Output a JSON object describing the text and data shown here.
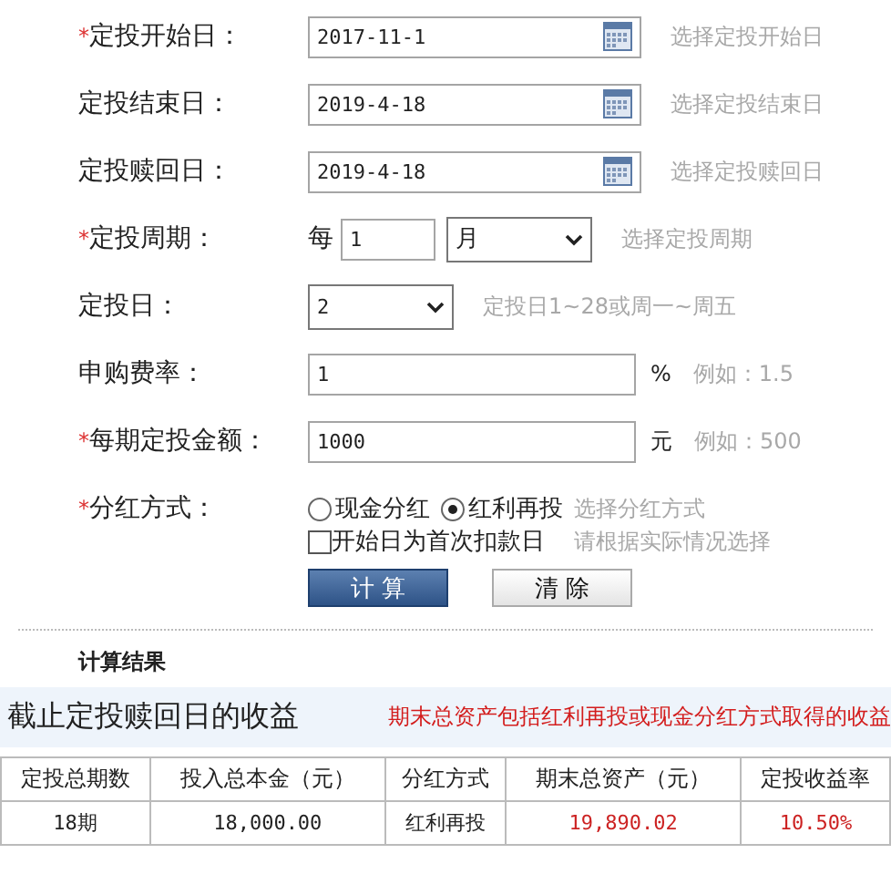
{
  "form": {
    "rows": [
      {
        "kind": "date",
        "mark": "*",
        "label": "定投开始日：",
        "value": "2017-11-1",
        "hint": "选择定投开始日"
      },
      {
        "kind": "date",
        "label": "定投结束日：",
        "value": "2019-4-18",
        "hint": "选择定投结束日"
      },
      {
        "kind": "date",
        "label": "定投赎回日：",
        "value": "2019-4-18",
        "hint": "选择定投赎回日"
      },
      {
        "kind": "period",
        "mark": "*",
        "label": "定投周期：",
        "prefix": "每",
        "value": "1",
        "unit_value": "月",
        "hint": "选择定投周期"
      },
      {
        "kind": "select",
        "label": "定投日：",
        "value": "2",
        "hint": "定投日1~28或周一~周五"
      },
      {
        "kind": "text",
        "label": "申购费率：",
        "value": "1",
        "unit": "%",
        "hint": "例如：1.5"
      },
      {
        "kind": "text",
        "mark": "*",
        "label": "每期定投金额：",
        "value": "1000",
        "unit": "元",
        "hint": "例如：500"
      },
      {
        "kind": "radio",
        "mark": "*",
        "label": "分红方式：",
        "options": [
          {
            "label": "现金分红",
            "selected": false
          },
          {
            "label": "红利再投",
            "selected": true
          }
        ],
        "hint": "选择分红方式"
      },
      {
        "kind": "checkbox",
        "label_text": "开始日为首次扣款日",
        "checked": false,
        "hint": "请根据实际情况选择"
      }
    ],
    "buttons": [
      {
        "label": "计 算",
        "kind": "primary"
      },
      {
        "label": "清 除",
        "kind": "secondary"
      }
    ]
  },
  "results": {
    "title": "计算结果",
    "subtitle": "截止定投赎回日的收益",
    "note": "期末总资产包括红利再投或现金分红方式取得的收益",
    "table": {
      "columns": [
        "定投总期数",
        "投入总本金（元）",
        "分红方式",
        "期末总资产（元）",
        "定投收益率"
      ],
      "rows": [
        {
          "cells": [
            "18期",
            "18,000.00",
            "红利再投",
            "19,890.02",
            "10.50%"
          ],
          "highlight": [
            false,
            false,
            false,
            true,
            true
          ]
        }
      ]
    }
  }
}
